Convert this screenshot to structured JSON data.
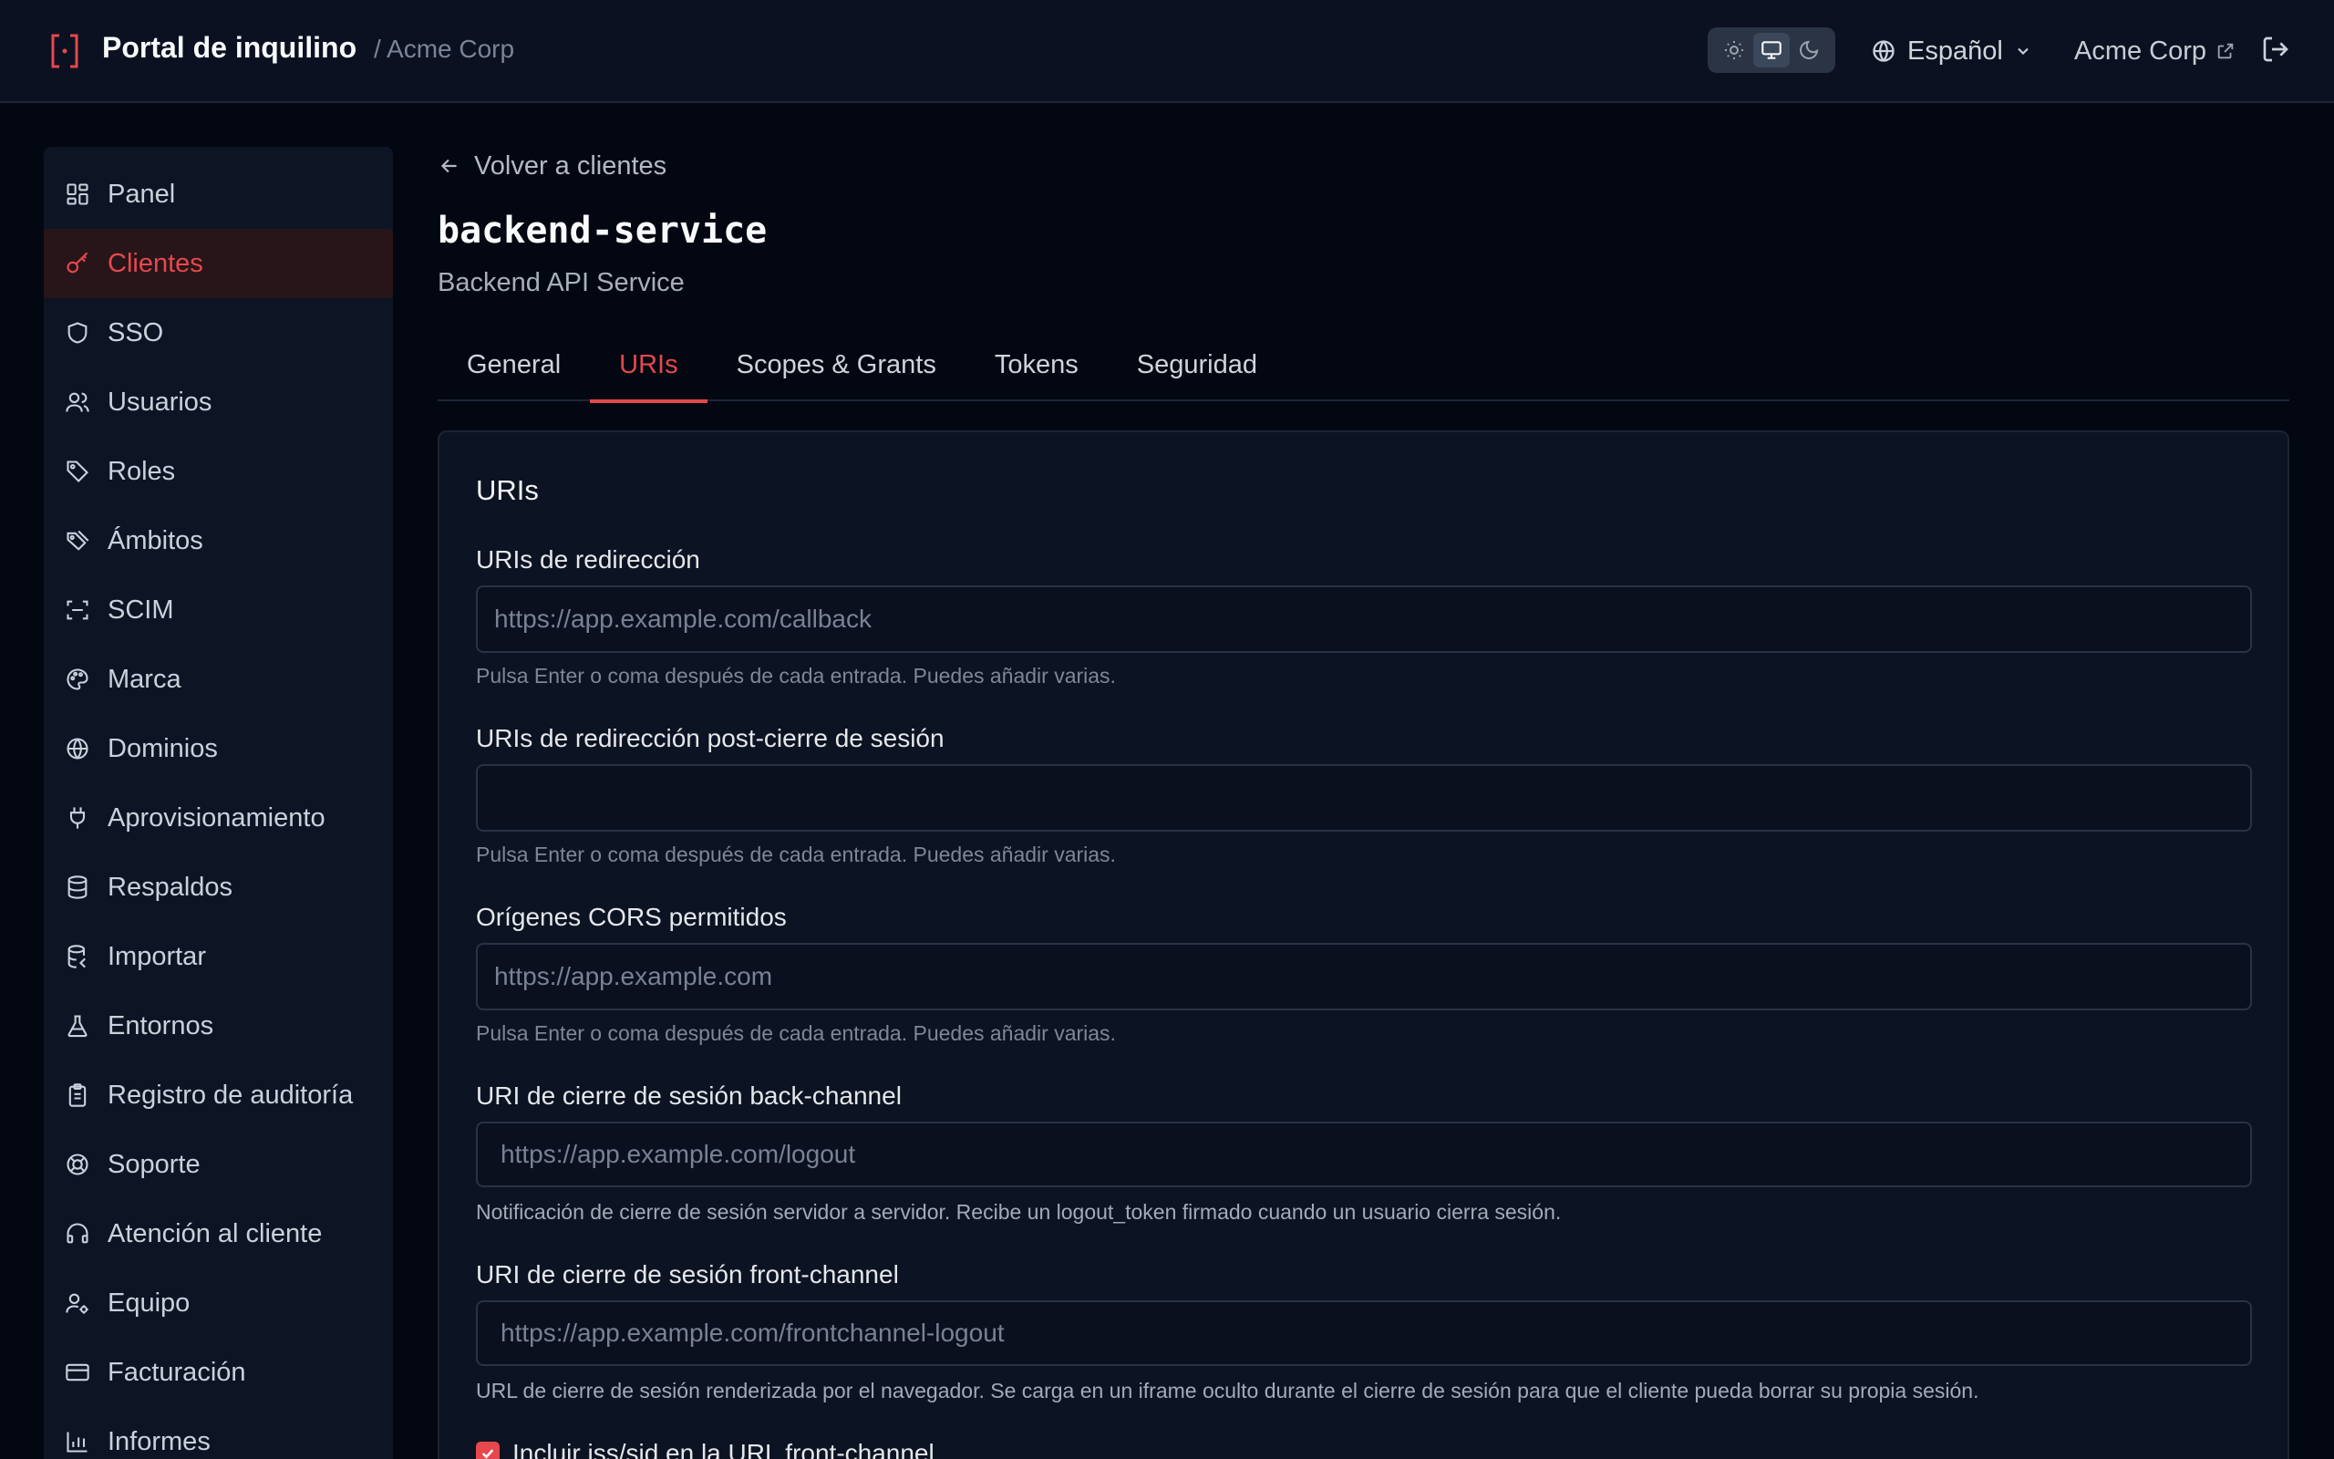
{
  "header": {
    "app_title": "Portal de inquilino",
    "breadcrumb": "/ Acme Corp",
    "theme_options": [
      "light",
      "system",
      "dark"
    ],
    "theme_selected": "system",
    "language": "Español",
    "tenant_link": "Acme Corp"
  },
  "colors": {
    "accent": "#e5484d",
    "background": "#030711",
    "surface": "#0c1322"
  },
  "sidebar": {
    "items": [
      {
        "label": "Panel",
        "icon": "dashboard-icon"
      },
      {
        "label": "Clientes",
        "icon": "key-icon",
        "active": true
      },
      {
        "label": "SSO",
        "icon": "shield-icon"
      },
      {
        "label": "Usuarios",
        "icon": "users-icon"
      },
      {
        "label": "Roles",
        "icon": "tag-icon"
      },
      {
        "label": "Ámbitos",
        "icon": "tags-icon"
      },
      {
        "label": "SCIM",
        "icon": "scan-icon"
      },
      {
        "label": "Marca",
        "icon": "palette-icon"
      },
      {
        "label": "Dominios",
        "icon": "globe-icon"
      },
      {
        "label": "Aprovisionamiento",
        "icon": "plug-icon"
      },
      {
        "label": "Respaldos",
        "icon": "database-icon"
      },
      {
        "label": "Importar",
        "icon": "database-import-icon"
      },
      {
        "label": "Entornos",
        "icon": "flask-icon"
      },
      {
        "label": "Registro de auditoría",
        "icon": "clipboard-icon"
      },
      {
        "label": "Soporte",
        "icon": "lifebuoy-icon"
      },
      {
        "label": "Atención al cliente",
        "icon": "headset-icon"
      },
      {
        "label": "Equipo",
        "icon": "user-cog-icon"
      },
      {
        "label": "Facturación",
        "icon": "credit-card-icon"
      },
      {
        "label": "Informes",
        "icon": "bar-chart-icon"
      }
    ]
  },
  "main": {
    "back_link": "Volver a clientes",
    "title": "backend-service",
    "subtitle": "Backend API Service",
    "tabs": [
      {
        "label": "General"
      },
      {
        "label": "URIs",
        "active": true
      },
      {
        "label": "Scopes & Grants"
      },
      {
        "label": "Tokens"
      },
      {
        "label": "Seguridad"
      }
    ]
  },
  "card": {
    "title": "URIs",
    "fields": {
      "redirect": {
        "label": "URIs de redirección",
        "placeholder": "https://app.example.com/callback",
        "value": "",
        "hint": "Pulsa Enter o coma después de cada entrada. Puedes añadir varias."
      },
      "post_logout": {
        "label": "URIs de redirección post-cierre de sesión",
        "placeholder": "",
        "value": "",
        "hint": "Pulsa Enter o coma después de cada entrada. Puedes añadir varias."
      },
      "cors": {
        "label": "Orígenes CORS permitidos",
        "placeholder": "https://app.example.com",
        "value": "",
        "hint": "Pulsa Enter o coma después de cada entrada. Puedes añadir varias."
      },
      "backchannel": {
        "label": "URI de cierre de sesión back-channel",
        "placeholder": "https://app.example.com/logout",
        "value": "",
        "hint": "Notificación de cierre de sesión servidor a servidor. Recibe un logout_token firmado cuando un usuario cierra sesión."
      },
      "frontchannel": {
        "label": "URI de cierre de sesión front-channel",
        "placeholder": "https://app.example.com/frontchannel-logout",
        "value": "",
        "hint": "URL de cierre de sesión renderizada por el navegador. Se carga en un iframe oculto durante el cierre de sesión para que el cliente pueda borrar su propia sesión."
      }
    },
    "checkbox": {
      "label": "Incluir iss/sid en la URL front-channel",
      "checked": true
    }
  }
}
